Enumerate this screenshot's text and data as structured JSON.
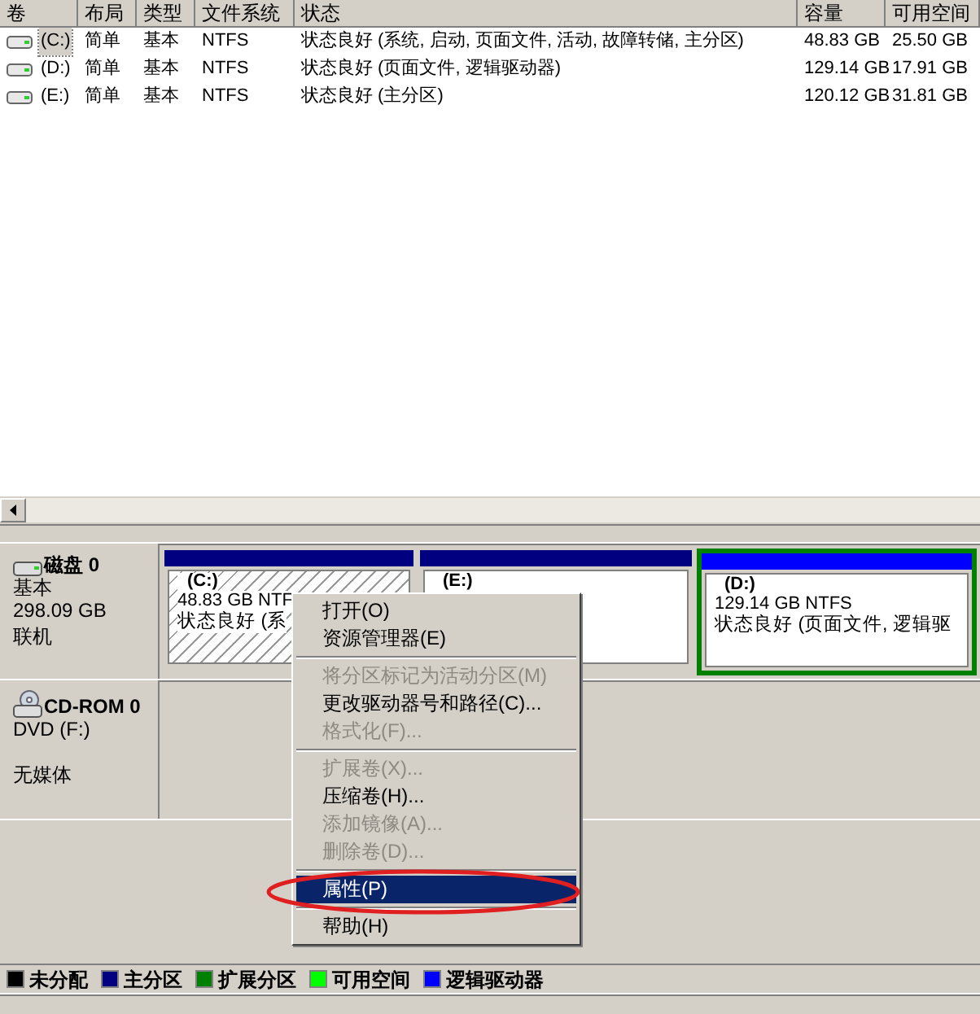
{
  "volume_table": {
    "columns": [
      "卷",
      "布局",
      "类型",
      "文件系统",
      "状态",
      "容量",
      "可用空间"
    ],
    "rows": [
      {
        "cells": [
          "(C:)",
          "简单",
          "基本",
          "NTFS",
          "状态良好 (系统, 启动, 页面文件, 活动, 故障转储, 主分区)",
          "48.83 GB",
          "25.50 GB"
        ],
        "selected": true
      },
      {
        "cells": [
          "(D:)",
          "简单",
          "基本",
          "NTFS",
          "状态良好 (页面文件, 逻辑驱动器)",
          "129.14 GB",
          "17.91 GB"
        ],
        "selected": false
      },
      {
        "cells": [
          "(E:)",
          "简单",
          "基本",
          "NTFS",
          "状态良好 (主分区)",
          "120.12 GB",
          "31.81 GB"
        ],
        "selected": false
      }
    ]
  },
  "disks": [
    {
      "kind": "disk",
      "name": "磁盘 0",
      "lines": [
        "基本",
        "298.09 GB",
        "联机"
      ],
      "partitions": [
        {
          "label": "(C:)",
          "size": "48.83 GB NTF",
          "status": "状态良好 (系",
          "color": "#000080",
          "hatched": true,
          "selected": false
        },
        {
          "label": "(E:)",
          "color": "#000080",
          "hatched": false,
          "selected": false
        },
        {
          "label": "(D:)",
          "size": "129.14 GB NTFS",
          "status": "状态良好 (页面文件, 逻辑驱",
          "color": "#0000ff",
          "hatched": false,
          "selected": true
        }
      ]
    },
    {
      "kind": "cdrom",
      "name": "CD-ROM 0",
      "lines": [
        "DVD (F:)",
        "无媒体"
      ]
    }
  ],
  "context_menu": [
    {
      "kind": "item",
      "label": "打开(O)",
      "disabled": false,
      "selected": false
    },
    {
      "kind": "item",
      "label": "资源管理器(E)",
      "disabled": false,
      "selected": false
    },
    {
      "kind": "separator"
    },
    {
      "kind": "item",
      "label": "将分区标记为活动分区(M)",
      "disabled": true,
      "selected": false
    },
    {
      "kind": "item",
      "label": "更改驱动器号和路径(C)...",
      "disabled": false,
      "selected": false
    },
    {
      "kind": "item",
      "label": "格式化(F)...",
      "disabled": true,
      "selected": false
    },
    {
      "kind": "separator"
    },
    {
      "kind": "item",
      "label": "扩展卷(X)...",
      "disabled": true,
      "selected": false
    },
    {
      "kind": "item",
      "label": "压缩卷(H)...",
      "disabled": false,
      "selected": false
    },
    {
      "kind": "item",
      "label": "添加镜像(A)...",
      "disabled": true,
      "selected": false
    },
    {
      "kind": "item",
      "label": "删除卷(D)...",
      "disabled": true,
      "selected": false
    },
    {
      "kind": "separator"
    },
    {
      "kind": "item",
      "label": "属性(P)",
      "disabled": false,
      "selected": true
    },
    {
      "kind": "separator"
    },
    {
      "kind": "item",
      "label": "帮助(H)",
      "disabled": false,
      "selected": false
    }
  ],
  "legend": [
    {
      "label": "未分配",
      "color": "#000000"
    },
    {
      "label": "主分区",
      "color": "#000080"
    },
    {
      "label": "扩展分区",
      "color": "#008000"
    },
    {
      "label": "可用空间",
      "color": "#00ff00"
    },
    {
      "label": "逻辑驱动器",
      "color": "#0000ff"
    }
  ]
}
